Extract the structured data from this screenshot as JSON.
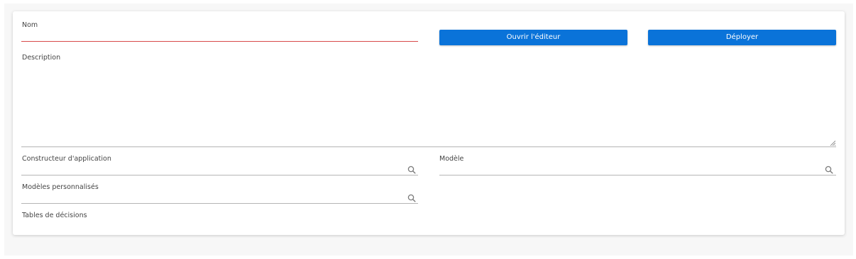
{
  "form": {
    "nom_label": "Nom",
    "nom_value": "",
    "description_label": "Description",
    "description_value": "",
    "constructeur_label": "Constructeur d'application",
    "constructeur_value": "",
    "modele_label": "Modèle",
    "modele_value": "",
    "modeles_perso_label": "Modèles personnalisés",
    "modeles_perso_value": "",
    "tables_decisions_label": "Tables de décisions"
  },
  "actions": {
    "open_editor_label": "Ouvrir l'éditeur",
    "deploy_label": "Déployer"
  },
  "colors": {
    "primary": "#0a73d9",
    "error_underline": "#d84a4a",
    "underline": "#b5b5b5"
  },
  "icons": {
    "lookup": "search-icon",
    "textarea_resize": "resize-handle-icon"
  }
}
